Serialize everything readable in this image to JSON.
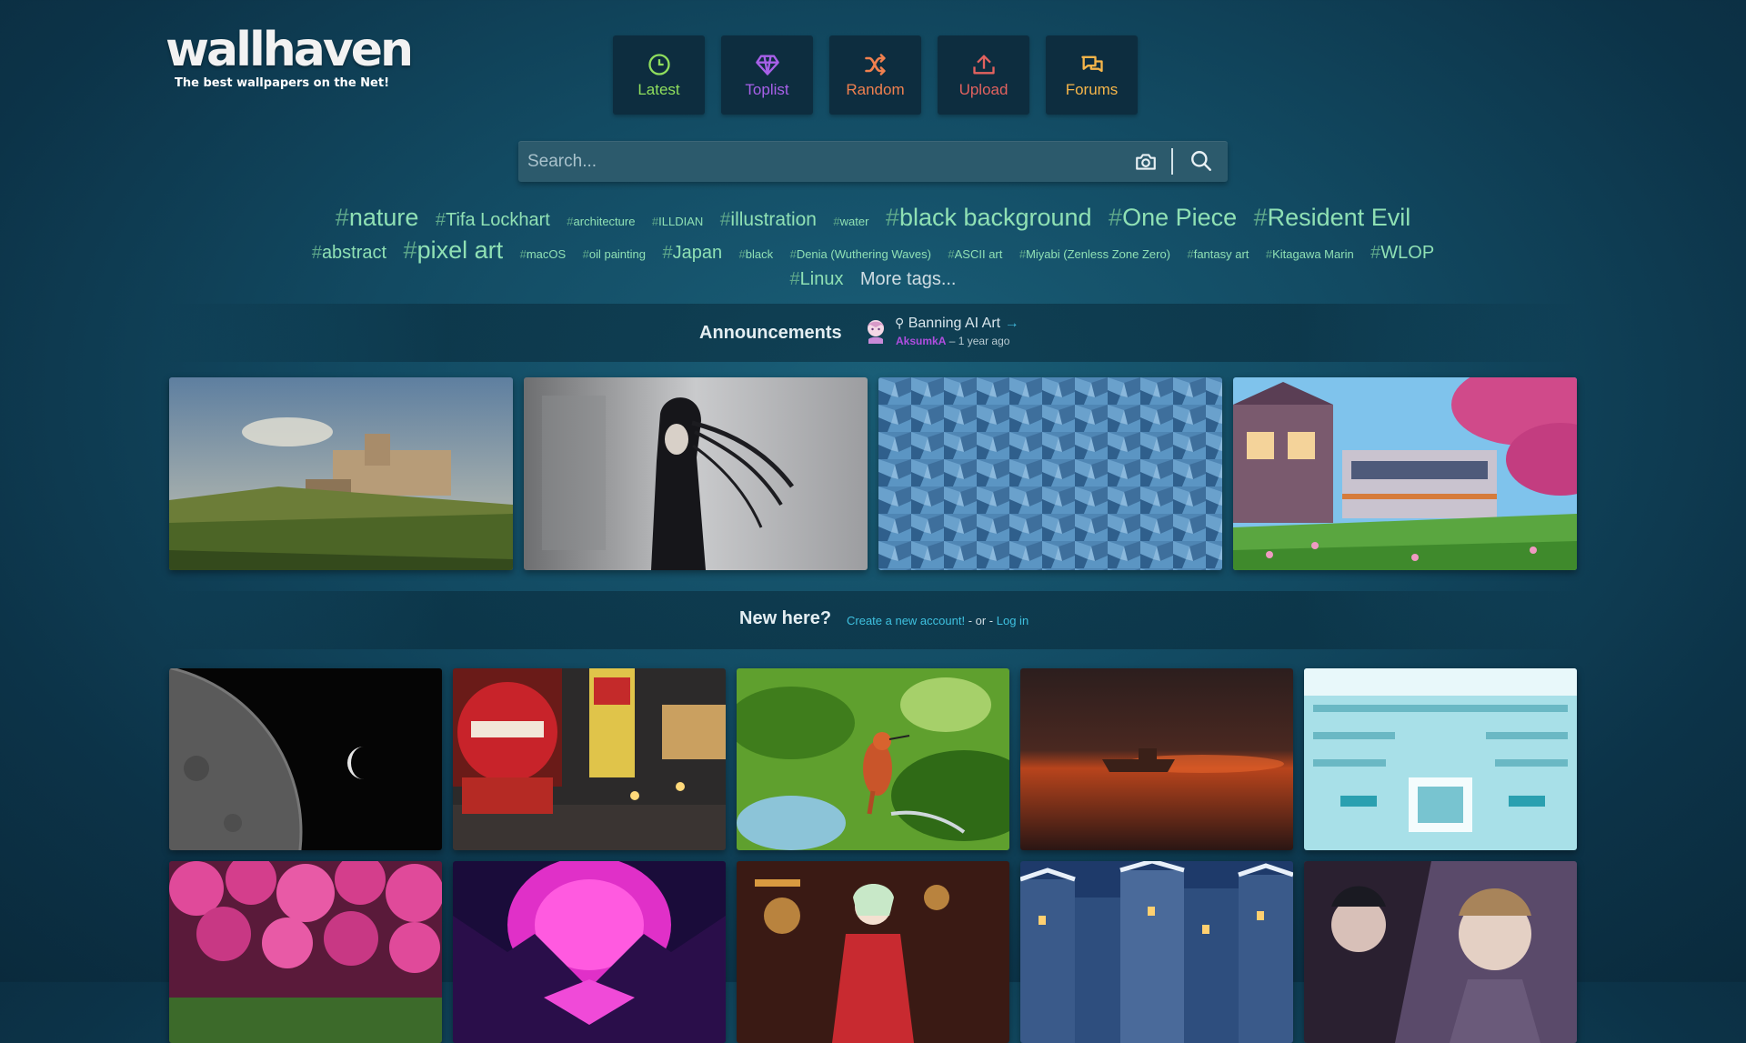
{
  "logo": {
    "name": "wallhaven",
    "tagline": "The best wallpapers on the Net!"
  },
  "nav": [
    {
      "label": "Latest",
      "icon": "clock-icon",
      "color": "#8fde5d"
    },
    {
      "label": "Toplist",
      "icon": "diamond-icon",
      "color": "#a760e8"
    },
    {
      "label": "Random",
      "icon": "shuffle-icon",
      "color": "#f0804f"
    },
    {
      "label": "Upload",
      "icon": "upload-icon",
      "color": "#e2625f"
    },
    {
      "label": "Forums",
      "icon": "chat-bubbles-icon",
      "color": "#f5b54a"
    }
  ],
  "search": {
    "placeholder": "Search...",
    "value": ""
  },
  "tags": {
    "hash": "#",
    "row1": [
      "nature",
      "Tifa Lockhart",
      "architecture",
      "ILLDIAN",
      "illustration",
      "water",
      "black background",
      "One Piece",
      "Resident Evil"
    ],
    "row2": [
      "abstract",
      "pixel art",
      "macOS",
      "oil painting",
      "Japan",
      "black",
      "Denia (Wuthering Waves)",
      "ASCII art",
      "Miyabi (Zenless Zone Zero)",
      "fantasy art",
      "Kitagawa Marin",
      "WLOP"
    ],
    "row3": [
      "Linux"
    ],
    "more": "More tags..."
  },
  "announcements": {
    "title": "Announcements",
    "post_title": "Banning AI Art",
    "author": "AksumkA",
    "time": "– 1 year ago"
  },
  "newhere": {
    "title": "New here?",
    "create": "Create a new account!",
    "or": " - or - ",
    "login": "Log in"
  },
  "colors": {
    "accent": "#3fc1e0",
    "tag": "#8fe0b4",
    "background": "#124a62"
  }
}
